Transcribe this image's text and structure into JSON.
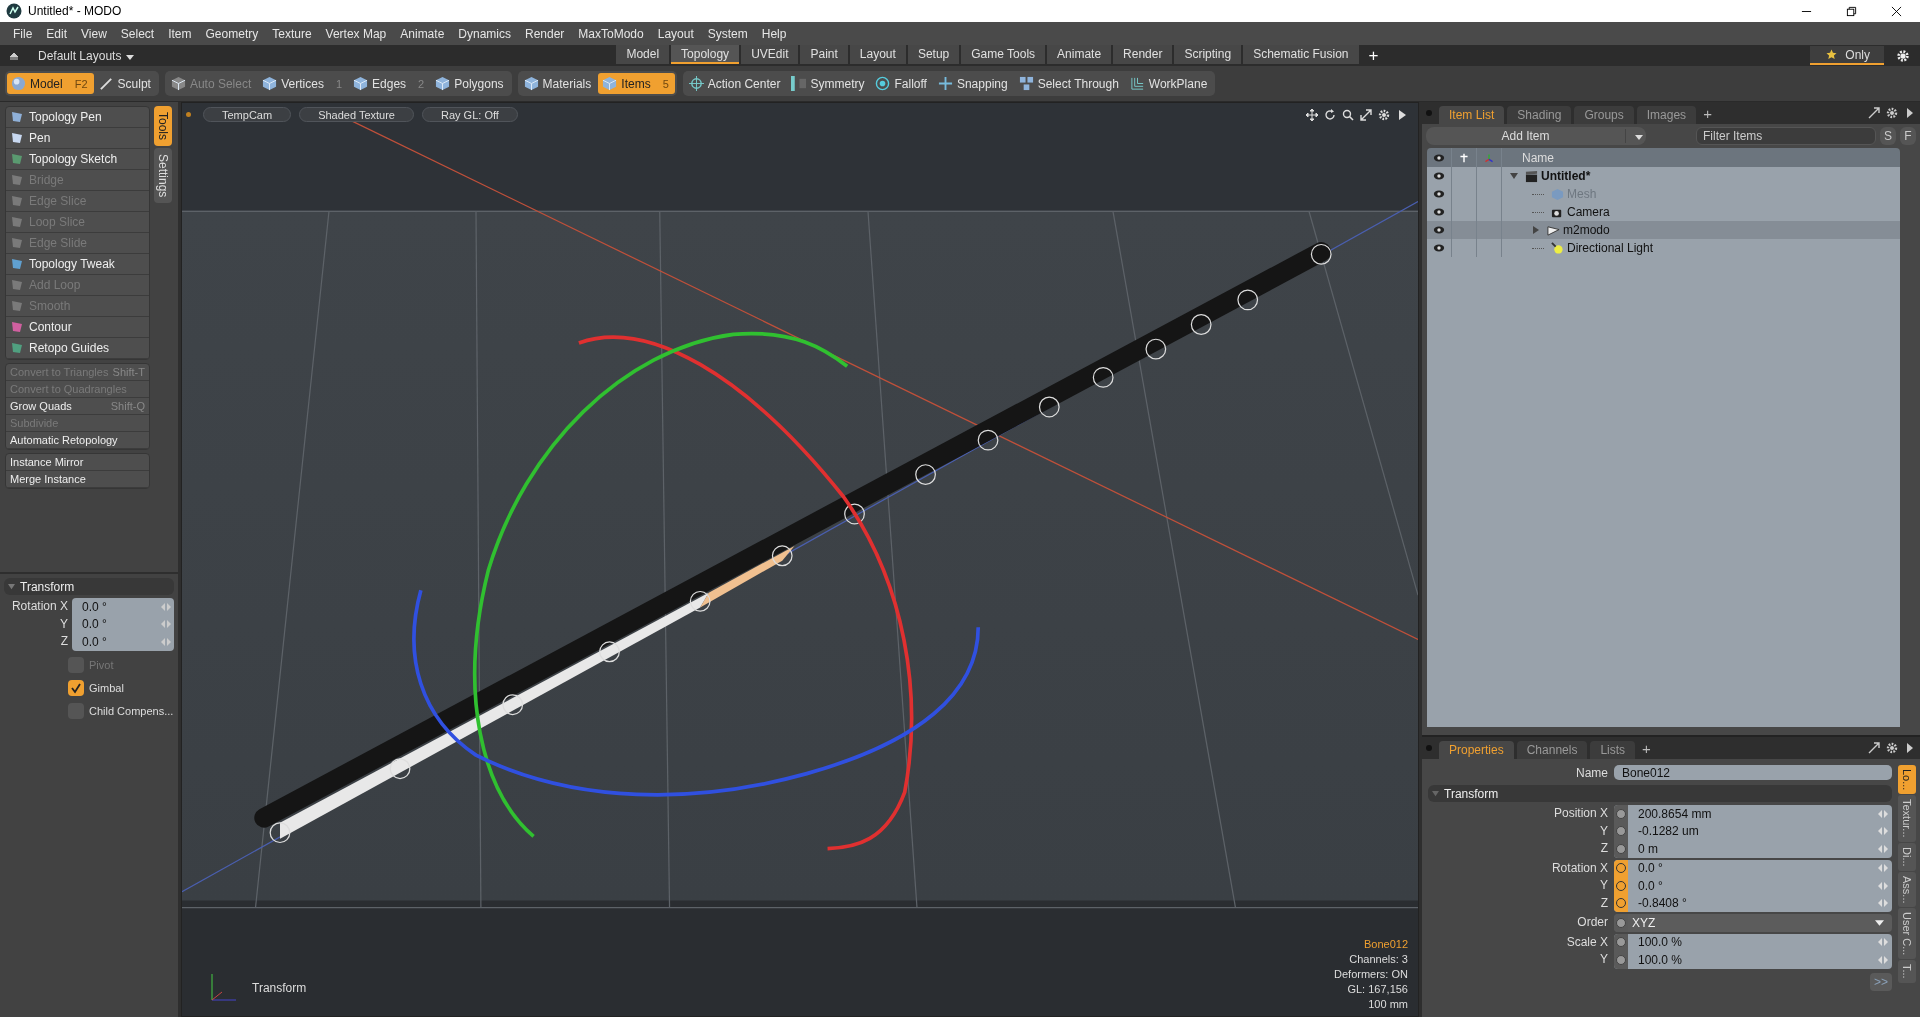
{
  "window": {
    "title": "Untitled* - MODO"
  },
  "menu": [
    "File",
    "Edit",
    "View",
    "Select",
    "Item",
    "Geometry",
    "Texture",
    "Vertex Map",
    "Animate",
    "Dynamics",
    "Render",
    "MaxToModo",
    "Layout",
    "System",
    "Help"
  ],
  "layout_menu": "Default Layouts",
  "layout_tabs": [
    {
      "label": "Model",
      "selected": false
    },
    {
      "label": "Topology",
      "selected": true
    },
    {
      "label": "UVEdit",
      "selected": false
    },
    {
      "label": "Paint",
      "selected": false
    },
    {
      "label": "Layout",
      "selected": false
    },
    {
      "label": "Setup",
      "selected": false
    },
    {
      "label": "Game Tools",
      "selected": false
    },
    {
      "label": "Animate",
      "selected": false
    },
    {
      "label": "Render",
      "selected": false
    },
    {
      "label": "Scripting",
      "selected": false
    },
    {
      "label": "Schematic Fusion",
      "selected": false
    }
  ],
  "add_tab": "+",
  "only_toggle": {
    "label": "Only",
    "on": true
  },
  "modes": [
    {
      "label": "Model",
      "key": "F2",
      "selected": true
    },
    {
      "label": "Sculpt",
      "selected": false
    }
  ],
  "toolbar_groups": [
    [
      {
        "label": "Auto Select",
        "disabled": true,
        "selected": false
      },
      {
        "label": "Vertices",
        "key": "1",
        "disabled": false,
        "selected": false
      },
      {
        "label": "Edges",
        "key": "2",
        "disabled": false,
        "selected": false
      },
      {
        "label": "Polygons",
        "disabled": false,
        "selected": false
      }
    ],
    [
      {
        "label": "Materials",
        "disabled": false,
        "selected": false
      },
      {
        "label": "Items",
        "key": "5",
        "disabled": false,
        "selected": true
      }
    ],
    [
      {
        "label": "Action Center",
        "disabled": false,
        "selected": false
      },
      {
        "label": "Symmetry",
        "disabled": false,
        "selected": false
      },
      {
        "label": "Falloff",
        "disabled": false,
        "selected": false
      },
      {
        "label": "Snapping",
        "disabled": false,
        "selected": false
      },
      {
        "label": "Select Through",
        "disabled": false,
        "selected": false
      },
      {
        "label": "WorkPlane",
        "disabled": false,
        "selected": false
      }
    ]
  ],
  "tool_tabs": [
    {
      "label": "Tools",
      "selected": true
    },
    {
      "label": "Settings",
      "selected": false
    }
  ],
  "tool_groups": [
    {
      "kind": "tools",
      "items": [
        {
          "label": "Topology Pen",
          "disabled": false
        },
        {
          "label": "Pen",
          "disabled": false
        },
        {
          "label": "Topology Sketch",
          "disabled": false
        },
        {
          "label": "Bridge",
          "disabled": true
        },
        {
          "label": "Edge Slice",
          "disabled": true
        },
        {
          "label": "Loop Slice",
          "disabled": true
        },
        {
          "label": "Edge Slide",
          "disabled": true
        },
        {
          "label": "Topology Tweak",
          "disabled": false
        },
        {
          "label": "Add Loop",
          "disabled": true
        },
        {
          "label": "Smooth",
          "disabled": true
        },
        {
          "label": "Contour",
          "disabled": false
        },
        {
          "label": "Retopo Guides",
          "disabled": false
        }
      ]
    },
    {
      "kind": "commands",
      "items": [
        {
          "label": "Convert to Triangles",
          "shortcut": "Shift-T",
          "disabled": true
        },
        {
          "label": "Convert to Quadrangles",
          "disabled": true
        },
        {
          "label": "Grow Quads",
          "shortcut": "Shift-Q",
          "disabled": false
        },
        {
          "label": "Subdivide",
          "disabled": true
        },
        {
          "label": "Automatic Retopology",
          "disabled": false
        }
      ]
    },
    {
      "kind": "commands",
      "items": [
        {
          "label": "Instance Mirror",
          "disabled": false
        },
        {
          "label": "Merge Instance",
          "disabled": false
        }
      ]
    }
  ],
  "transform_panel": {
    "title": "Transform",
    "fields": [
      {
        "label": "Rotation X",
        "value": "0.0 °"
      },
      {
        "label": "Y",
        "value": "0.0 °"
      },
      {
        "label": "Z",
        "value": "0.0 °"
      }
    ],
    "options": [
      {
        "label": "Pivot",
        "checked": false,
        "disabled": true
      },
      {
        "label": "Gimbal",
        "checked": true,
        "disabled": false
      },
      {
        "label": "Child Compens...",
        "checked": false,
        "disabled": false
      }
    ]
  },
  "viewport": {
    "buttons": [
      "TempCam",
      "Shaded Texture",
      "Ray GL: Off"
    ],
    "tool_label": "Transform",
    "info": [
      {
        "text": "Bone012",
        "kind": "highlight"
      },
      {
        "text": "Channels: 3",
        "kind": "plain"
      },
      {
        "text": "Deformers: ON",
        "kind": "plain"
      },
      {
        "text": "GL: 167,156",
        "kind": "plain"
      },
      {
        "text": "100 mm",
        "kind": "plain"
      }
    ]
  },
  "item_list": {
    "tabs": [
      {
        "label": "Item List",
        "selected": true
      },
      {
        "label": "Shading",
        "selected": false
      },
      {
        "label": "Groups",
        "selected": false
      },
      {
        "label": "Images",
        "selected": false
      }
    ],
    "add_tab": "+",
    "add_button": "Add Item",
    "filter_placeholder": "Filter Items",
    "filter_buttons": [
      "S",
      "F"
    ],
    "column": "Name",
    "tree": [
      {
        "name": "Untitled*",
        "kind": "scene",
        "expanded": true,
        "selected": false,
        "disabled": false,
        "children": [
          {
            "name": "Mesh",
            "kind": "mesh",
            "selected": false,
            "disabled": true
          },
          {
            "name": "Camera",
            "kind": "camera",
            "selected": false,
            "disabled": false
          },
          {
            "name": "m2modo",
            "kind": "group",
            "expanded": false,
            "selected": true,
            "disabled": false
          },
          {
            "name": "Directional Light",
            "kind": "light",
            "selected": false,
            "disabled": false
          }
        ]
      }
    ]
  },
  "properties": {
    "tabs": [
      {
        "label": "Properties",
        "selected": true
      },
      {
        "label": "Channels",
        "selected": false
      },
      {
        "label": "Lists",
        "selected": false
      }
    ],
    "add_tab": "+",
    "name_label": "Name",
    "name_value": "Bone012",
    "section": "Transform",
    "groups": [
      {
        "kind": "numeric",
        "rows": [
          {
            "label": "Position X",
            "value": "200.8654 mm",
            "animated": false
          },
          {
            "label": "Y",
            "value": "-0.1282 um",
            "animated": false
          },
          {
            "label": "Z",
            "value": "0 m",
            "animated": false
          }
        ]
      },
      {
        "kind": "numeric",
        "rows": [
          {
            "label": "Rotation X",
            "value": "0.0 °",
            "animated": true
          },
          {
            "label": "Y",
            "value": "0.0 °",
            "animated": true
          },
          {
            "label": "Z",
            "value": "-0.8408 °",
            "animated": true
          }
        ]
      },
      {
        "kind": "dropdown",
        "rows": [
          {
            "label": "Order",
            "value": "XYZ",
            "animated": false
          }
        ]
      },
      {
        "kind": "numeric",
        "rows": [
          {
            "label": "Scale X",
            "value": "100.0 %",
            "animated": false
          },
          {
            "label": "Y",
            "value": "100.0 %",
            "animated": false
          }
        ]
      }
    ],
    "more_button": ">>",
    "side_tabs": [
      {
        "label": "Lo...",
        "selected": true
      },
      {
        "label": "Textur...",
        "selected": false
      },
      {
        "label": "Di...",
        "selected": false
      },
      {
        "label": "Ass...",
        "selected": false
      },
      {
        "label": "User C...",
        "selected": false
      },
      {
        "label": "T...",
        "selected": false
      }
    ]
  }
}
